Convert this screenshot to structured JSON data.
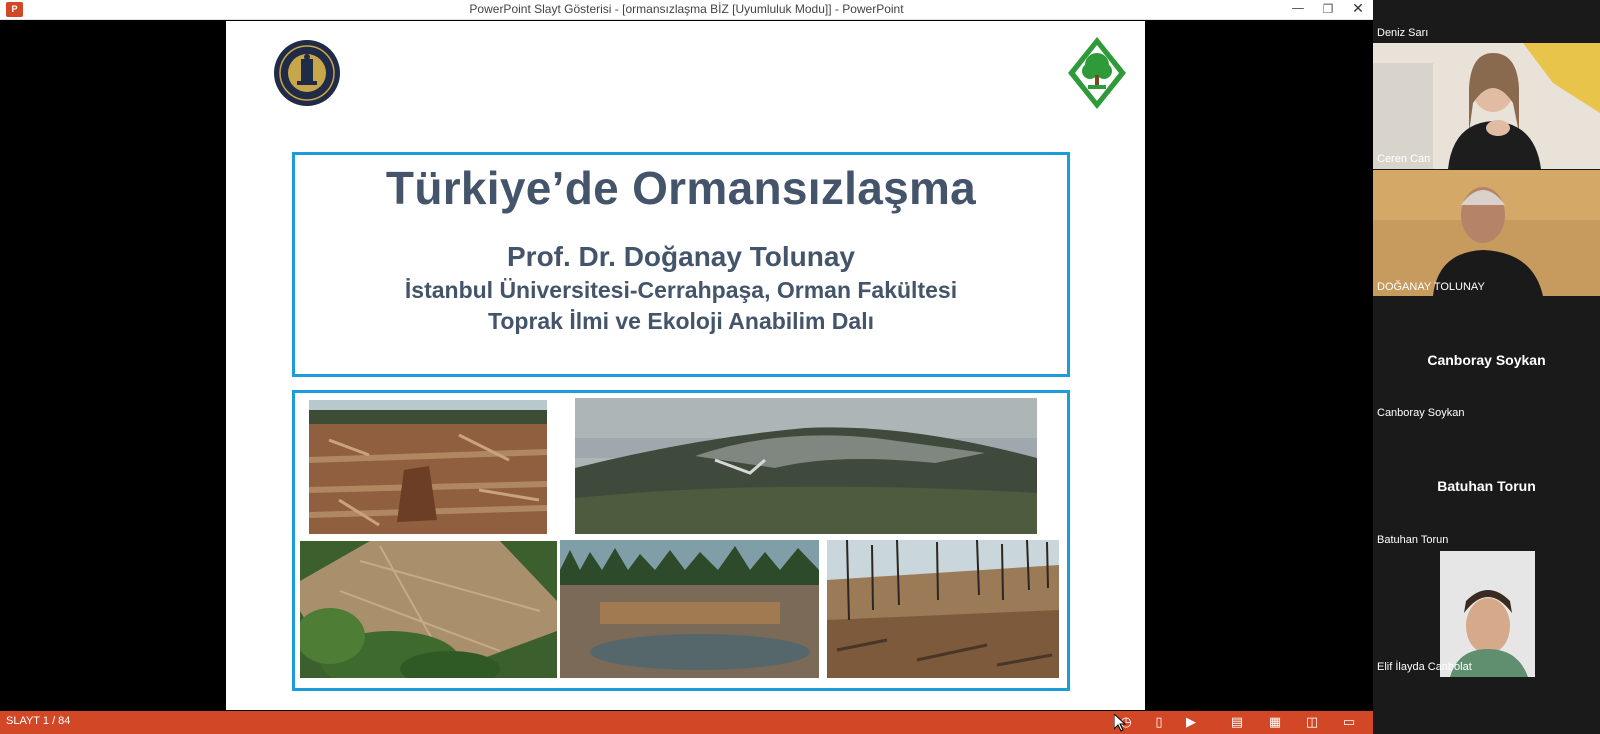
{
  "window": {
    "app_icon_label": "P",
    "title": "PowerPoint Slayt Gösterisi - [ormansızlaşma BİZ [Uyumluluk Modu]] - PowerPoint",
    "controls": {
      "minimize": "—",
      "restore": "❐",
      "close": "✕"
    }
  },
  "slide": {
    "title": "Türkiye’de Ormansızlaşma",
    "author": "Prof. Dr. Doğanay Tolunay",
    "affiliation_line1": "İstanbul Üniversitesi-Cerrahpaşa, Orman Fakültesi",
    "affiliation_line2": "Toprak İlmi ve Ekoloji Anabilim Dalı",
    "border_color": "#1a9dd9",
    "text_color": "#44546a"
  },
  "statusbar": {
    "slide_counter": "SLAYT 1 / 84",
    "color": "#d24726"
  },
  "participants": {
    "top_name": "Deniz Sarı",
    "p1": "Ceren Can",
    "p2": "DOĞANAY TOLUNAY",
    "p3_placeholder": "Canboray Soykan",
    "p3": "Canboray Soykan",
    "p4_placeholder": "Batuhan Torun",
    "p4": "Batuhan Torun",
    "p5": "Elif İlayda Canbolat"
  }
}
